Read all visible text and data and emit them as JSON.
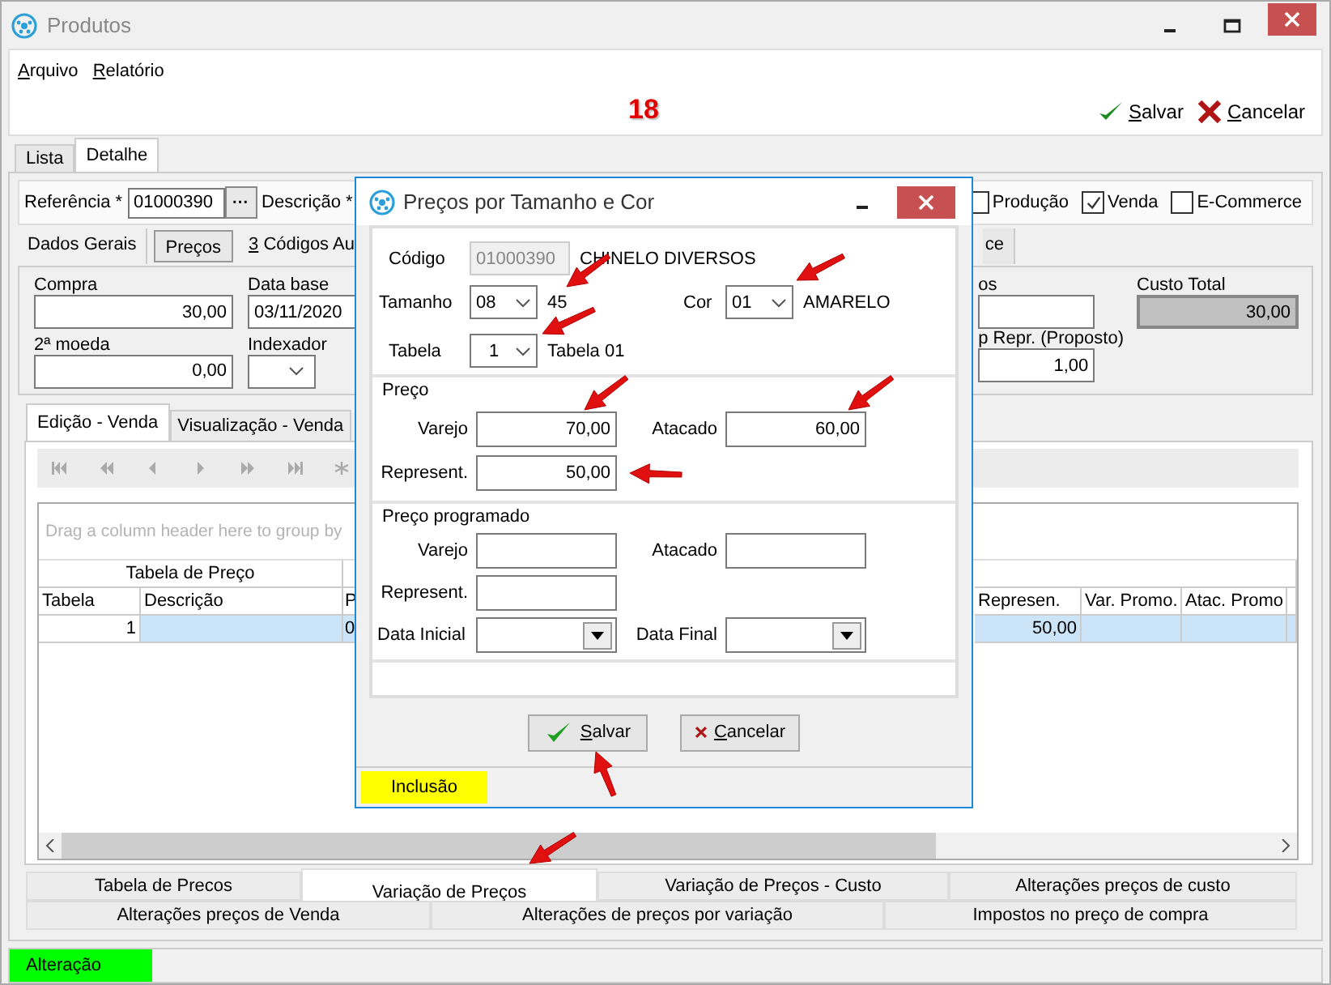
{
  "window": {
    "title": "Produtos"
  },
  "menu": [
    "Arquivo",
    "Relatório"
  ],
  "record_number": "18",
  "toolbar": [
    {
      "kind": "save",
      "label": "Salvar"
    },
    {
      "kind": "cancel",
      "label": "Cancelar"
    }
  ],
  "tabs": [
    {
      "label": "Lista",
      "selected": false
    },
    {
      "label": "Detalhe",
      "selected": true
    }
  ],
  "header": {
    "reference_label": "Referência *",
    "reference": "01000390",
    "browse_button": "···",
    "description_label": "Descrição *"
  },
  "flags": [
    {
      "label": "Produção",
      "checked": false
    },
    {
      "label": "Venda",
      "checked": true
    },
    {
      "label": "E-Commerce",
      "checked": false
    }
  ],
  "section_tabs": [
    {
      "label": "Dados Gerais",
      "selected": false
    },
    {
      "label": "Preços",
      "selected": true
    },
    {
      "label": "3 Códigos Au",
      "selected": false
    }
  ],
  "section_tabs_right": [
    {
      "label": "ce",
      "selected": false
    }
  ],
  "price_fields": [
    {
      "label": "Compra",
      "value": "30,00",
      "kind": "number"
    },
    {
      "label": "Data base",
      "value": "03/11/2020",
      "kind": "date"
    },
    {
      "label": "2ª moeda",
      "value": "0,00",
      "kind": "number"
    },
    {
      "label": "Indexador",
      "kind": "combo"
    }
  ],
  "price_fields_right": [
    {
      "label": "os"
    },
    {
      "label": "p Repr. (Proposto)",
      "value": "1,00"
    }
  ],
  "total_cost": {
    "label": "Custo Total",
    "value": "30,00"
  },
  "grid_tabs": [
    {
      "label": "Edição - Venda",
      "selected": true
    },
    {
      "label": "Visualização - Venda",
      "selected": false
    }
  ],
  "grid": {
    "group_hint": "Drag a column header here to group by",
    "group_header": "Tabela de Preço",
    "columns_left": [
      "Tabela",
      "Descrição",
      "P"
    ],
    "columns_right": [
      "Represen.",
      "Var. Promo.",
      "Atac. Promo"
    ],
    "rows": [
      {
        "tabela": "1",
        "column_3": "0",
        "represen": "50,00",
        "selected": true
      }
    ]
  },
  "bottom_tabs": [
    [
      {
        "label": "Tabela de Precos",
        "selected": false
      },
      {
        "label": "Variação de Preços",
        "selected": true
      },
      {
        "label": "Variação de Preços - Custo",
        "selected": false
      },
      {
        "label": "Alterações preços de custo",
        "selected": false
      }
    ],
    [
      {
        "label": "Alterações preços de Venda",
        "selected": false
      },
      {
        "label": "Alterações de preços por variação",
        "selected": false
      },
      {
        "label": "Impostos no preço de compra",
        "selected": false
      }
    ]
  ],
  "status_bar": {
    "mode": "Alteração"
  },
  "dialog": {
    "title": "Preços por Tamanho e Cor",
    "code_label": "Código",
    "code": "01000390",
    "product": "CHINELO DIVERSOS",
    "size_label": "Tamanho",
    "size": "08",
    "size_name": "45",
    "color_label": "Cor",
    "color_code": "01",
    "color_name": "AMARELO",
    "table_label": "Tabela",
    "table": "1",
    "table_name": "Tabela 01",
    "price": {
      "title": "Preço",
      "retail_label": "Varejo",
      "retail": "70,00",
      "wholesale_label": "Atacado",
      "wholesale": "60,00",
      "rep_label": "Represent.",
      "rep": "50,00"
    },
    "scheduled": {
      "title": "Preço programado",
      "retail_label": "Varejo",
      "wholesale_label": "Atacado",
      "rep_label": "Represent.",
      "start_label": "Data Inicial",
      "end_label": "Data Final"
    },
    "buttons": [
      {
        "kind": "save",
        "label": "Salvar"
      },
      {
        "kind": "cancel",
        "label": "Cancelar"
      }
    ],
    "status": "Inclusão"
  }
}
